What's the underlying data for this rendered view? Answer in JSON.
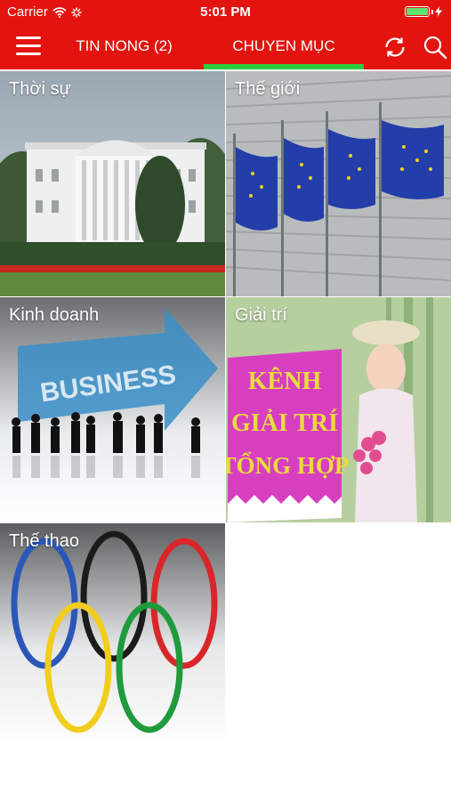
{
  "status_bar": {
    "carrier": "Carrier",
    "time": "5:01 PM"
  },
  "nav": {
    "tab_hot_news": "TIN NONG (2)",
    "tab_categories": "CHUYEN MỤC",
    "active_tab": "tab_categories",
    "icons": [
      "menu-icon",
      "refresh-icon",
      "search-icon"
    ]
  },
  "categories": [
    {
      "label": "Thời sự"
    },
    {
      "label": "Thế giới"
    },
    {
      "label": "Kinh doanh",
      "image_text": "BUSINESS"
    },
    {
      "label": "Giải trí",
      "image_text": [
        "KÊNH",
        "GIẢI TRÍ",
        "TỔNG HỢP"
      ]
    },
    {
      "label": "Thế thao"
    }
  ],
  "colors": {
    "brand_red": "#e3140f",
    "active_tab_underline": "#2ecc40",
    "text": "#ffffff"
  }
}
